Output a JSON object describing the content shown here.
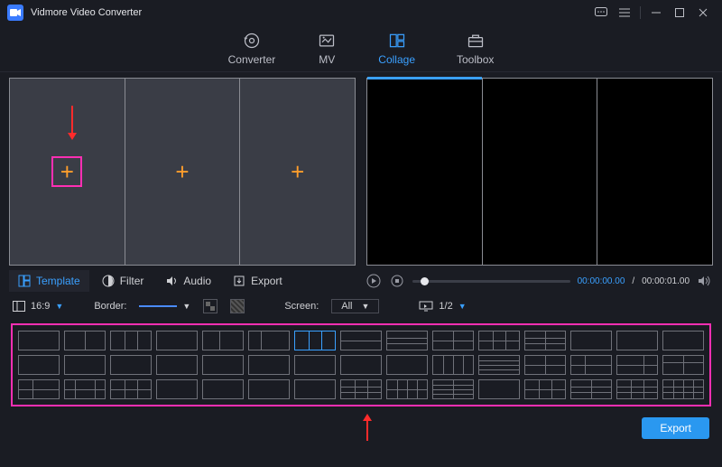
{
  "app": {
    "title": "Vidmore Video Converter"
  },
  "window_controls": {
    "feedback": "feedback",
    "menu": "menu",
    "minimize": "minimize",
    "maximize": "maximize",
    "close": "close"
  },
  "top_tabs": {
    "converter": "Converter",
    "mv": "MV",
    "collage": "Collage",
    "toolbox": "Toolbox",
    "active": "collage"
  },
  "bottom_tabs": {
    "template": "Template",
    "filter": "Filter",
    "audio": "Audio",
    "export": "Export",
    "active": "template"
  },
  "playback": {
    "current": "00:00:00.00",
    "duration": "00:00:01.00"
  },
  "options": {
    "ratio_label": "16:9",
    "border_label": "Border:",
    "screen_label": "Screen:",
    "screen_value": "All",
    "play_ratio": "1/2"
  },
  "export_button": "Export",
  "template_count": 45,
  "selected_template_index": 6
}
